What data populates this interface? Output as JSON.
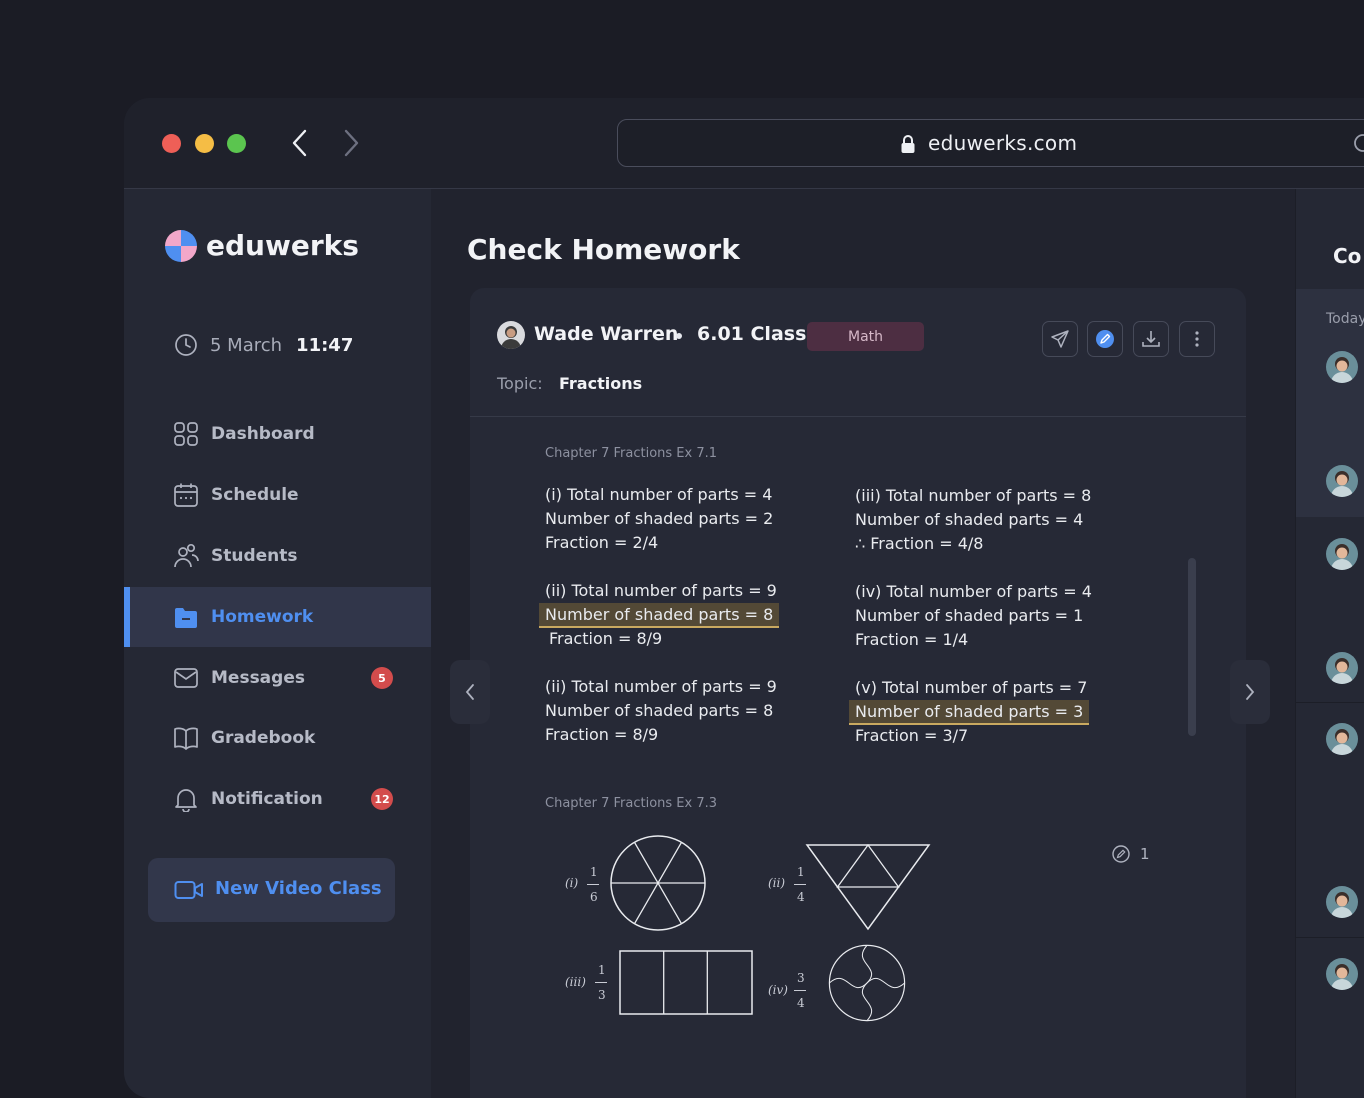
{
  "browser": {
    "url": "eduwerks.com"
  },
  "sidebar": {
    "logo": "eduwerks",
    "date": "5 March",
    "time": "11:47",
    "items": [
      {
        "label": "Dashboard",
        "icon": "grid-icon"
      },
      {
        "label": "Schedule",
        "icon": "calendar-icon"
      },
      {
        "label": "Students",
        "icon": "users-icon"
      },
      {
        "label": "Homework",
        "icon": "folder-icon",
        "active": true
      },
      {
        "label": "Messages",
        "icon": "mail-icon",
        "badge": "5"
      },
      {
        "label": "Gradebook",
        "icon": "book-icon"
      },
      {
        "label": "Notification",
        "icon": "bell-icon",
        "badge": "12"
      }
    ],
    "video_button": "New Video Class"
  },
  "main": {
    "title": "Check Homework",
    "student": "Wade Warren",
    "class": "6.01 Class",
    "subject_tag": "Math",
    "topic_label": "Topic:",
    "topic": "Fractions",
    "chapter1": "Chapter 7 Fractions Ex 7.1",
    "answers": {
      "i": [
        "(i) Total number of parts = 4",
        "Number of shaded parts = 2",
        "Fraction = 2/4"
      ],
      "ii": [
        "(ii) Total number of parts = 9",
        "Number of shaded parts = 8",
        "Fraction = 8/9"
      ],
      "ii_b": [
        "(ii) Total number of parts = 9",
        "Number of shaded parts = 8",
        "Fraction = 8/9"
      ],
      "iii": [
        "(iii) Total number of parts = 8",
        "Number of shaded parts = 4",
        "∴ Fraction = 4/8"
      ],
      "iv": [
        "(iv) Total number of parts = 4",
        "Number of shaded parts = 1",
        "Fraction = 1/4"
      ],
      "v": [
        "(v) Total number of parts = 7",
        "Number of shaded parts = 3",
        "Fraction = 3/7"
      ]
    },
    "chapter2": "Chapter 7 Fractions Ex 7.3",
    "comment_count": "1",
    "figures": {
      "f1": {
        "label": "(i)",
        "num": "1",
        "den": "6"
      },
      "f2": {
        "label": "(ii)",
        "num": "1",
        "den": "4"
      },
      "f3": {
        "label": "(iii)",
        "num": "1",
        "den": "3"
      },
      "f4": {
        "label": "(iv)",
        "num": "3",
        "den": "4"
      }
    }
  },
  "right_panel": {
    "title": "Co",
    "today": "Today"
  },
  "colors": {
    "accent": "#4f8ff0",
    "badge": "#d34c4c",
    "highlight": "#c9a960"
  }
}
